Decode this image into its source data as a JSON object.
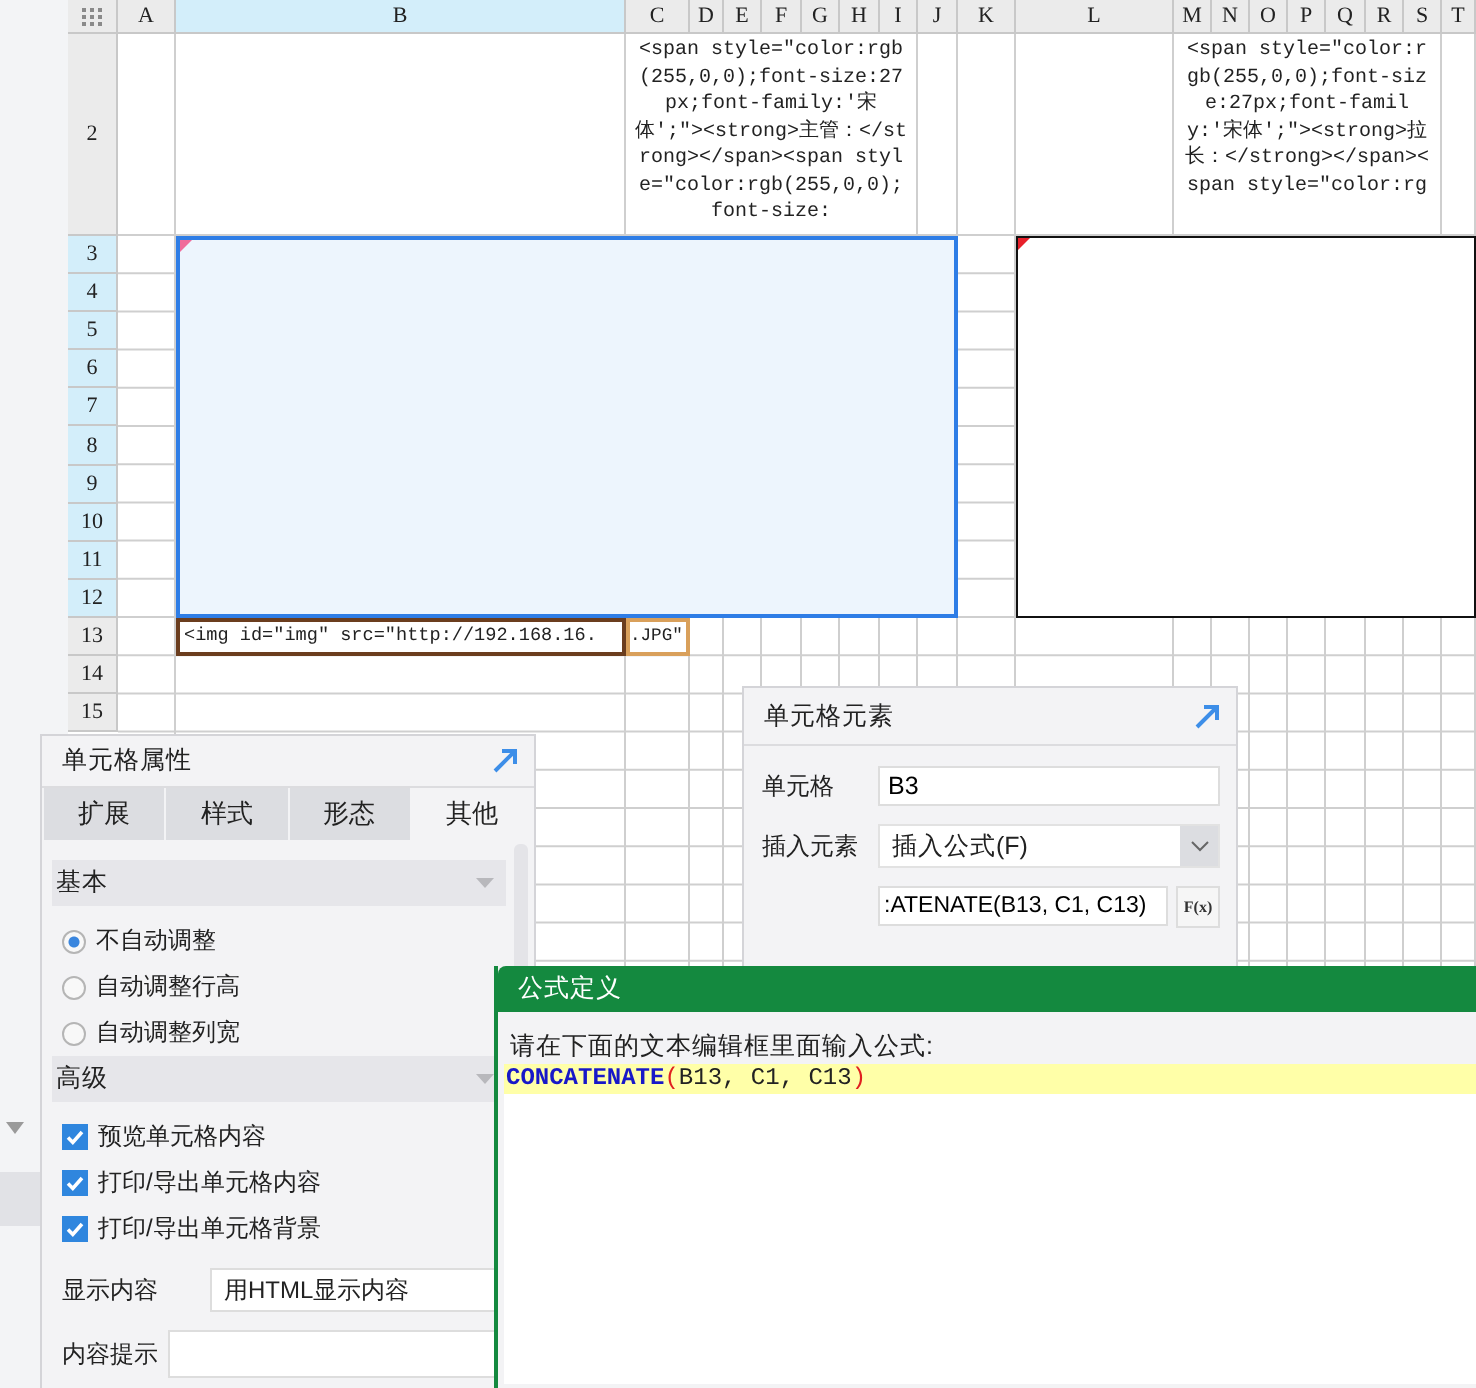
{
  "sheet": {
    "columns": [
      {
        "label": "A",
        "selected": false
      },
      {
        "label": "B",
        "selected": true
      },
      {
        "label": "C",
        "selected": false
      },
      {
        "label": "D",
        "selected": false
      },
      {
        "label": "E",
        "selected": false
      },
      {
        "label": "F",
        "selected": false
      },
      {
        "label": "G",
        "selected": false
      },
      {
        "label": "H",
        "selected": false
      },
      {
        "label": "I",
        "selected": false
      },
      {
        "label": "J",
        "selected": false
      },
      {
        "label": "K",
        "selected": false
      },
      {
        "label": "L",
        "selected": false
      },
      {
        "label": "M",
        "selected": false
      },
      {
        "label": "N",
        "selected": false
      },
      {
        "label": "O",
        "selected": false
      },
      {
        "label": "P",
        "selected": false
      },
      {
        "label": "Q",
        "selected": false
      },
      {
        "label": "R",
        "selected": false
      },
      {
        "label": "S",
        "selected": false
      },
      {
        "label": "T",
        "selected": false
      }
    ],
    "rows": [
      {
        "label": "2",
        "selected": false
      },
      {
        "label": "3",
        "selected": true
      },
      {
        "label": "4",
        "selected": true
      },
      {
        "label": "5",
        "selected": true
      },
      {
        "label": "6",
        "selected": true
      },
      {
        "label": "7",
        "selected": true
      },
      {
        "label": "8",
        "selected": true
      },
      {
        "label": "9",
        "selected": true
      },
      {
        "label": "10",
        "selected": true
      },
      {
        "label": "11",
        "selected": true
      },
      {
        "label": "12",
        "selected": true
      },
      {
        "label": "13",
        "selected": false
      },
      {
        "label": "14",
        "selected": false
      },
      {
        "label": "15",
        "selected": false
      }
    ],
    "cells": [
      {
        "kind": "code",
        "text": "<span style=\"color:rgb(255,0,0);font-size:27px;font-family:'宋体';\"><strong>主管：</strong></span><span style=\"color:rgb(255,0,0);font-size:"
      },
      {
        "kind": "code",
        "text": "<span style=\"color:rgb(255,0,0);font-size:27px;font-family:'宋体';\"><strong>拉长：</strong></span><span style=\"color:rg"
      },
      {
        "kind": "range",
        "selected": true
      },
      {
        "kind": "range",
        "selected": false
      },
      {
        "kind": "code",
        "text": "<img id=\"img\" src=\"http://192.168.16."
      },
      {
        "kind": "code",
        "text": ".JPG\""
      }
    ]
  },
  "cell_properties": {
    "title": "单元格属性",
    "tabs": [
      {
        "label": "扩展",
        "selected": false
      },
      {
        "label": "样式",
        "selected": false
      },
      {
        "label": "形态",
        "selected": false
      },
      {
        "label": "其他",
        "selected": true
      }
    ],
    "sections": [
      {
        "title": "基本",
        "items": [
          {
            "kind": "radio",
            "label": "不自动调整",
            "selected": true
          },
          {
            "kind": "radio",
            "label": "自动调整行高",
            "selected": false
          },
          {
            "kind": "radio",
            "label": "自动调整列宽",
            "selected": false
          }
        ]
      },
      {
        "title": "高级",
        "items": [
          {
            "kind": "checkbox",
            "label": "预览单元格内容",
            "checked": true
          },
          {
            "kind": "checkbox",
            "label": "打印/导出单元格内容",
            "checked": true
          },
          {
            "kind": "checkbox",
            "label": "打印/导出单元格背景",
            "checked": true
          }
        ]
      }
    ],
    "display_content": {
      "label": "显示内容",
      "value": "用HTML显示内容"
    },
    "content_hint": {
      "label": "内容提示"
    }
  },
  "cell_element": {
    "title": "单元格元素",
    "cell": {
      "label": "单元格",
      "value": "B3"
    },
    "insert_element": {
      "label": "插入元素",
      "value": "插入公式(F)"
    },
    "formula": {
      "value": ":ATENATE(B13, C1, C13)"
    },
    "fx_button": "F(x)"
  },
  "formula_dialog": {
    "title": "公式定义",
    "prompt": "请在下面的文本编辑框里面输入公式:",
    "tokens": [
      {
        "kind": "function",
        "text": "CONCATENATE"
      },
      {
        "kind": "paren",
        "text": "("
      },
      {
        "kind": "plain",
        "text": "B13, C1, C13"
      },
      {
        "kind": "paren",
        "text": ")"
      }
    ]
  }
}
